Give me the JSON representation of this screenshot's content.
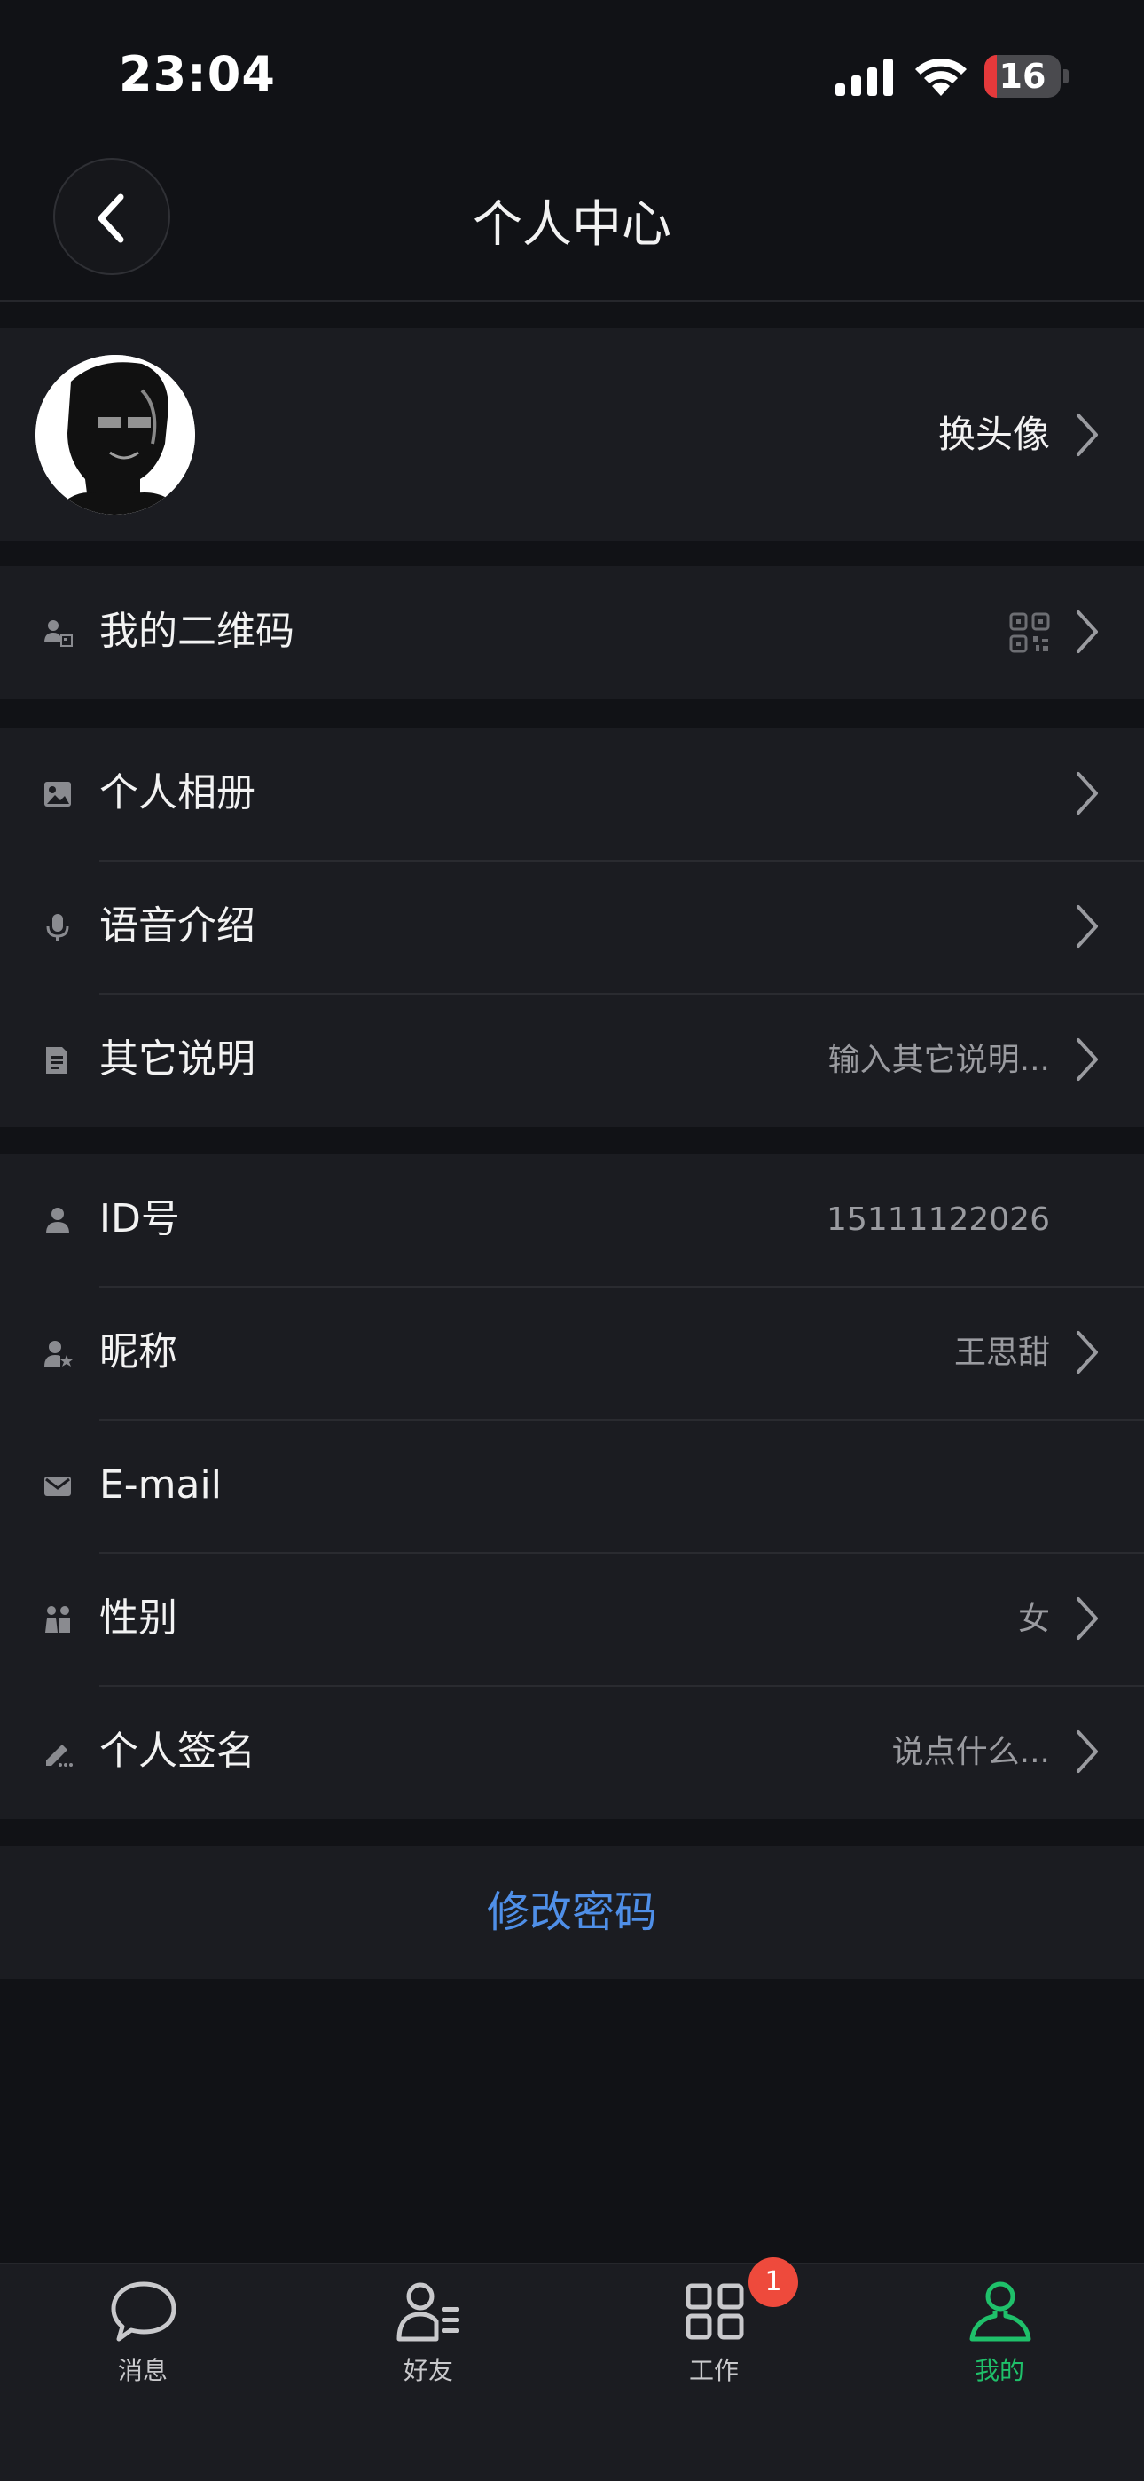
{
  "status_bar": {
    "time": "23:04",
    "battery_level": "16",
    "battery_fraction": 0.16,
    "battery_color": "#e5393b"
  },
  "header": {
    "title": "个人中心",
    "back_icon": "chevron-left-icon"
  },
  "avatar_row": {
    "action_label": "换头像"
  },
  "qrcode_row": {
    "label": "我的二维码",
    "icon": "qrcode-icon"
  },
  "media_group": [
    {
      "label": "个人相册",
      "icon": "photo-icon",
      "value": ""
    },
    {
      "label": "语音介绍",
      "icon": "microphone-icon",
      "value": ""
    },
    {
      "label": "其它说明",
      "icon": "note-icon",
      "value": "输入其它说明..."
    }
  ],
  "info_group": [
    {
      "label": "ID号",
      "icon": "person-icon",
      "value": "15111122026"
    },
    {
      "label": "昵称",
      "icon": "person-star-icon",
      "value": "王思甜"
    },
    {
      "label": "E-mail",
      "icon": "mail-icon",
      "value": ""
    },
    {
      "label": "性别",
      "icon": "gender-icon",
      "value": "女"
    },
    {
      "label": "个人签名",
      "icon": "pen-icon",
      "value": "说点什么..."
    }
  ],
  "change_password_label": "修改密码",
  "tabbar": {
    "items": [
      {
        "label": "消息",
        "icon": "chat-bubble-icon"
      },
      {
        "label": "好友",
        "icon": "contacts-icon"
      },
      {
        "label": "工作",
        "icon": "grid-icon",
        "badge": "1"
      },
      {
        "label": "我的",
        "icon": "user-icon"
      }
    ],
    "active_color": "#1fc06a"
  },
  "colors": {
    "background": "#111216",
    "card": "#1b1c21",
    "link": "#4f8fe8",
    "badge": "#ee4a3c"
  }
}
